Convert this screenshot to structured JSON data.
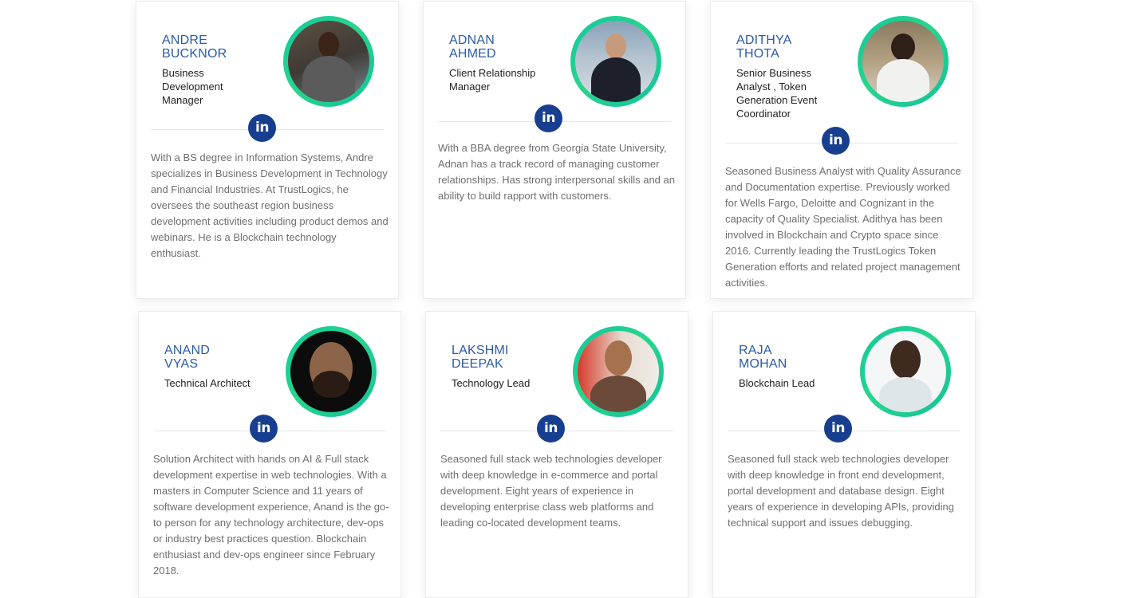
{
  "team": [
    {
      "first": "ANDRE",
      "last": "BUCKNOR",
      "role": "Business Development Manager",
      "bio": "With a BS degree in Information Systems, Andre specializes in Business Development in Technology and Financial Industries. At TrustLogics, he oversees the southeast region business development activities including product demos and webinars. He is a Blockchain technology enthusiast."
    },
    {
      "first": "ADNAN",
      "last": "AHMED",
      "role": "Client Relationship Manager",
      "bio": "With a BBA degree from Georgia State University, Adnan has a track record of managing customer relationships. Has strong interpersonal skills and an ability to build rapport with customers."
    },
    {
      "first": "ADITHYA",
      "last": "THOTA",
      "role": "Senior Business Analyst , Token Generation Event Coordinator",
      "bio": "Seasoned Business Analyst with Quality Assurance and Documentation expertise. Previously worked for Wells Fargo, Deloitte and Cognizant in the capacity of Quality Specialist. Adithya has been involved in Blockchain and Crypto space since 2016. Currently leading the TrustLogics Token Generation efforts and related project management activities."
    },
    {
      "first": "ANAND",
      "last": "VYAS",
      "role": "Technical Architect",
      "bio": "Solution Architect with hands on AI & Full stack development expertise in web technologies. With a masters in Computer Science and 11 years of software development experience, Anand is the go-to person for any technology architecture, dev-ops or industry best practices question. Blockchain enthusiast and dev-ops engineer since February 2018."
    },
    {
      "first": "LAKSHMI",
      "last": "DEEPAK",
      "role": "Technology Lead",
      "bio": "Seasoned full stack web technologies developer with deep knowledge in e-commerce and portal development. Eight years of experience in developing enterprise class web platforms and leading co-located development teams."
    },
    {
      "first": "RAJA",
      "last": "MOHAN",
      "role": "Blockchain Lead",
      "bio": "Seasoned full stack web technologies developer with deep knowledge in front end development, portal development and database design. Eight years of experience in developing APIs, providing technical support and issues debugging."
    }
  ],
  "linkedin_label": "in",
  "colors": {
    "name": "#2b5aa8",
    "linkedin": "#173e8f",
    "ring_start": "#12c8a0",
    "ring_end": "#27d58c",
    "bio_text": "#6f6f6f"
  },
  "icons": {
    "linkedin": "linkedin-icon"
  }
}
